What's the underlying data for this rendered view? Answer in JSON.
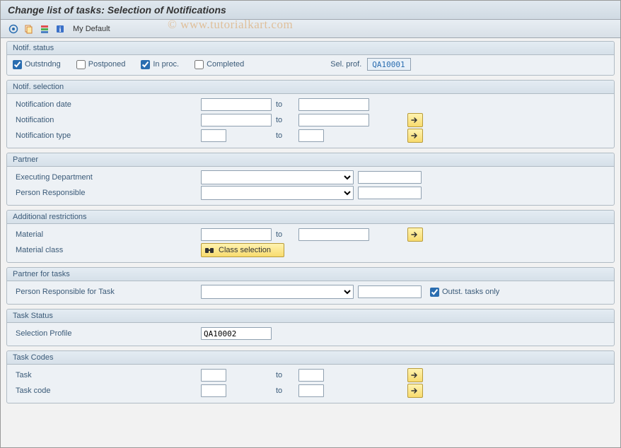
{
  "title": "Change list of tasks: Selection of Notifications",
  "toolbar": {
    "my_default": "My Default"
  },
  "watermark": "© www.tutorialkart.com",
  "status": {
    "group_title": "Notif. status",
    "outstanding_label": "Outstndng",
    "postponed_label": "Postponed",
    "inproc_label": "In proc.",
    "completed_label": "Completed",
    "selprof_label": "Sel. prof.",
    "selprof_value": "QA10001"
  },
  "selection": {
    "group_title": "Notif. selection",
    "date_label": "Notification date",
    "notif_label": "Notification",
    "type_label": "Notification type",
    "to_label": "to"
  },
  "partner": {
    "group_title": "Partner",
    "exec_dept_label": "Executing Department",
    "resp_label": "Person Responsible"
  },
  "restrictions": {
    "group_title": "Additional restrictions",
    "material_label": "Material",
    "matclass_label": "Material class",
    "class_sel_btn": "Class selection",
    "to_label": "to"
  },
  "partner_tasks": {
    "group_title": "Partner for tasks",
    "resp_task_label": "Person Responsible for Task",
    "outst_only_label": "Outst. tasks only"
  },
  "task_status": {
    "group_title": "Task Status",
    "selprof_label": "Selection Profile",
    "selprof_value": "QA10002"
  },
  "task_codes": {
    "group_title": "Task Codes",
    "task_label": "Task",
    "taskcode_label": "Task code",
    "to_label": "to"
  }
}
